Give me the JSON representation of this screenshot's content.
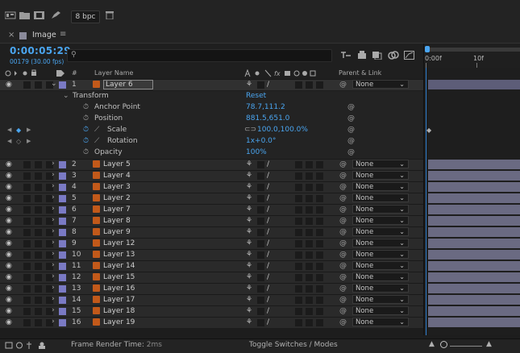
{
  "toolbar": {
    "bpc_label": "8 bpc",
    "icons": [
      "composition-flowchart-icon",
      "folder-icon",
      "film-icon",
      "pen-icon",
      "trash-icon"
    ]
  },
  "tab": {
    "close": "×",
    "title": "Image",
    "menu": "≡"
  },
  "controls": {
    "timecode": "0:00:05:29",
    "timecode_sub": "00179 (30.00 fps)",
    "search_placeholder": "",
    "search_icon": "⚲"
  },
  "ruler": {
    "start_label": "0:00f",
    "mark_label": "10f"
  },
  "columns": {
    "source_hash": "#",
    "layer_name": "Layer Name",
    "parent_link": "Parent & Link"
  },
  "expanded_layer": {
    "num": "1",
    "name": "Layer 6",
    "parent": "None"
  },
  "transform": {
    "label": "Transform",
    "reset": "Reset",
    "props": [
      {
        "name": "Anchor Point",
        "value": "78.7,111.2"
      },
      {
        "name": "Position",
        "value": "881.5,651.0"
      },
      {
        "name": "Scale",
        "value": "100.0,100.0%"
      },
      {
        "name": "Rotation",
        "value": "1x+0.0°"
      },
      {
        "name": "Opacity",
        "value": "100%"
      }
    ]
  },
  "layers": [
    {
      "num": "2",
      "name": "Layer 5",
      "parent": "None"
    },
    {
      "num": "3",
      "name": "Layer 4",
      "parent": "None"
    },
    {
      "num": "4",
      "name": "Layer 3",
      "parent": "None"
    },
    {
      "num": "5",
      "name": "Layer 2",
      "parent": "None"
    },
    {
      "num": "6",
      "name": "Layer 7",
      "parent": "None"
    },
    {
      "num": "7",
      "name": "Layer 8",
      "parent": "None"
    },
    {
      "num": "8",
      "name": "Layer 9",
      "parent": "None"
    },
    {
      "num": "9",
      "name": "Layer 12",
      "parent": "None"
    },
    {
      "num": "10",
      "name": "Layer 13",
      "parent": "None"
    },
    {
      "num": "11",
      "name": "Layer 14",
      "parent": "None"
    },
    {
      "num": "12",
      "name": "Layer 15",
      "parent": "None"
    },
    {
      "num": "13",
      "name": "Layer 16",
      "parent": "None"
    },
    {
      "num": "14",
      "name": "Layer 17",
      "parent": "None"
    },
    {
      "num": "15",
      "name": "Layer 18",
      "parent": "None"
    },
    {
      "num": "16",
      "name": "Layer 19",
      "parent": "None"
    }
  ],
  "bottom": {
    "frame_render_label": "Frame Render Time:",
    "frame_render_value": "2ms",
    "toggle_label": "Toggle Switches / Modes"
  },
  "colors": {
    "accent": "#4aa5f0",
    "label_violet": "#7a7ac4",
    "source_orange": "#c2591a",
    "track_bar": "#6a6a82"
  }
}
